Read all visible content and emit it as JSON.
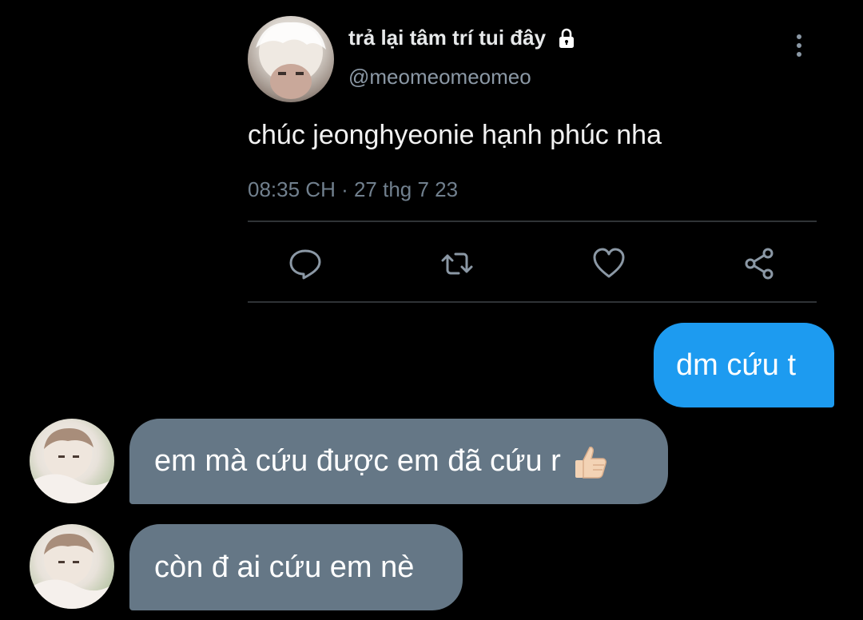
{
  "tweet": {
    "display_name": "trả lại tâm trí tui đây",
    "handle": "@meomeomeomeo",
    "text": "chúc jeonghyeonie hạnh phúc nha",
    "timestamp": "08:35 CH · 27 thg 7 23",
    "icons": {
      "protected": "lock-icon",
      "more": "more-vertical-icon",
      "reply": "reply-icon",
      "retweet": "retweet-icon",
      "like": "heart-icon",
      "share": "share-icon"
    }
  },
  "messages": [
    {
      "direction": "sent",
      "text": "dm cứu t"
    },
    {
      "direction": "received",
      "text": "em mà cứu được em đã cứu r",
      "emoji": "thumbs-up-icon"
    },
    {
      "direction": "received",
      "text": "còn đ ai cứu em nè"
    }
  ],
  "colors": {
    "background": "#000000",
    "sent_bubble": "#1d9bf0",
    "received_bubble": "#657786",
    "secondary_text": "#8b98a5",
    "icon_stroke": "#8b98a5"
  }
}
